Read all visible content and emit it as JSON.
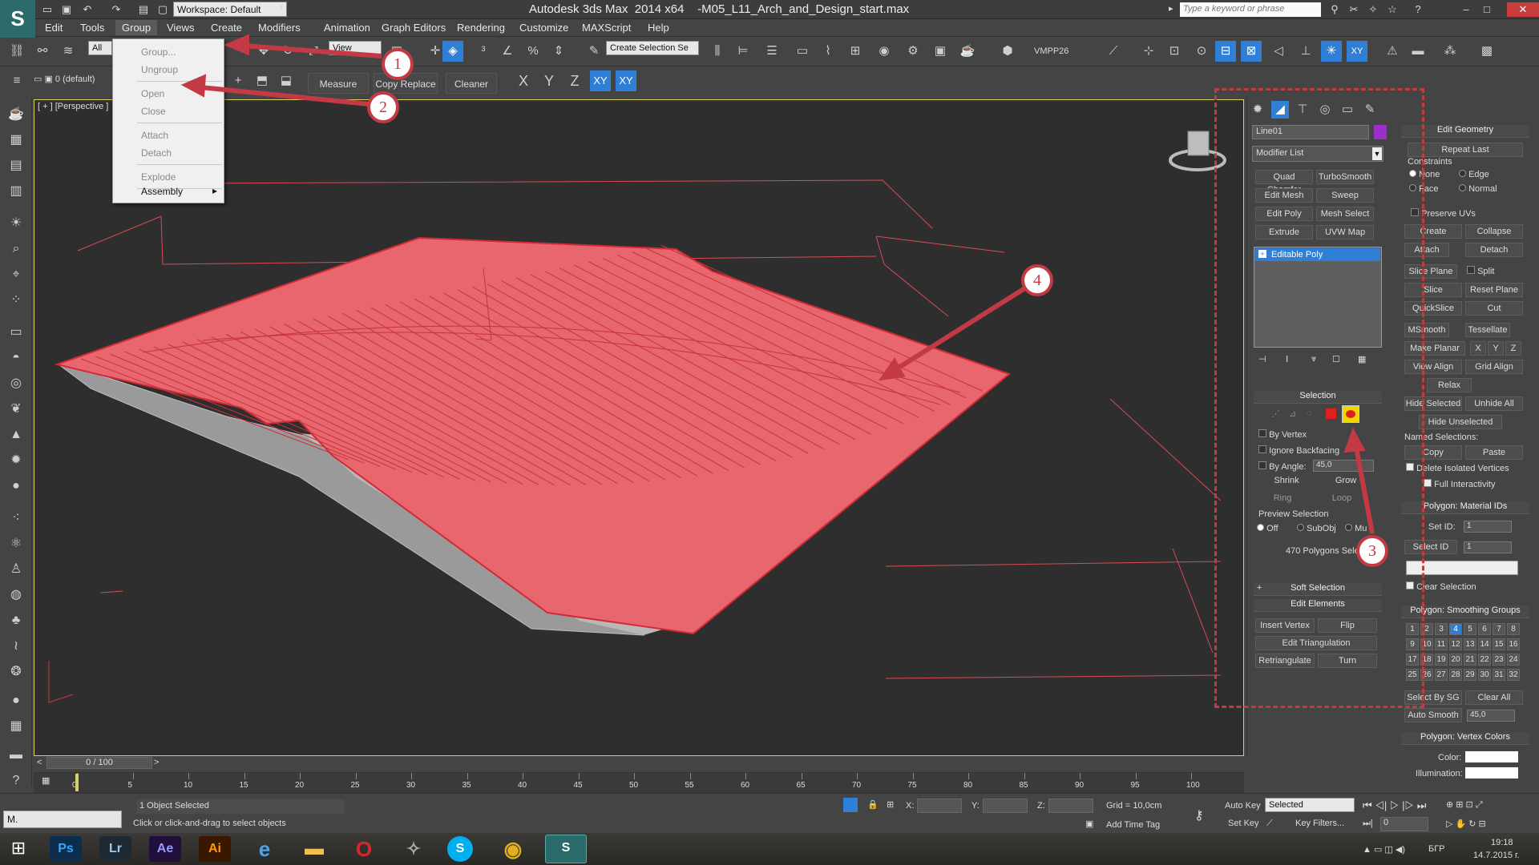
{
  "title": {
    "app": "Autodesk 3ds Max  2014 x64",
    "file": "-M05_L11_Arch_and_Design_start.max",
    "workspace": "Workspace: Default",
    "search_placeholder": "Type a keyword or phrase"
  },
  "menu": [
    "Edit",
    "Tools",
    "Group",
    "Views",
    "Create",
    "Modifiers",
    "Animation",
    "Graph Editors",
    "Rendering",
    "Customize",
    "MAXScript",
    "Help"
  ],
  "group_menu": {
    "items": [
      "Group...",
      "Ungroup",
      "Open",
      "Close",
      "Attach",
      "Detach",
      "Explode",
      "Assembly"
    ],
    "submenu_arrow": "▸"
  },
  "toolbar": {
    "filter": "All",
    "view_dropdown": "View",
    "create_selection": "Create Selection Se",
    "vmpp": "VMPP26",
    "layer": "0 (default)",
    "measure": "Measure",
    "copy_replace": "Copy Replace",
    "cleaner": "Cleaner",
    "axis_x": "X",
    "axis_y": "Y",
    "axis_z": "Z",
    "axis_xy": "XY",
    "axis_xy2": "XY"
  },
  "viewport": {
    "label": "[ + ] [Perspective ]"
  },
  "command_panel": {
    "object_name": "Line01",
    "modifier_list": "Modifier List",
    "modifier_buttons": [
      [
        "Quad Chamfer",
        "TurboSmooth"
      ],
      [
        "Edit Mesh",
        "Sweep"
      ],
      [
        "Edit Poly",
        "Mesh Select"
      ],
      [
        "Extrude",
        "UVW Map"
      ]
    ],
    "stack_item": "Editable Poly",
    "selection": {
      "title": "Selection",
      "by_vertex": "By Vertex",
      "ignore_backfacing": "Ignore Backfacing",
      "by_angle": "By Angle:",
      "angle_value": "45,0",
      "shrink": "Shrink",
      "grow": "Grow",
      "ring": "Ring",
      "loop": "Loop",
      "preview_selection": "Preview Selection",
      "off": "Off",
      "subobj": "SubObj",
      "multi": "Mu",
      "status": "470 Polygons Sele"
    },
    "soft_selection": "Soft Selection",
    "edit_elements": {
      "title": "Edit Elements",
      "insert_vertex": "Insert Vertex",
      "flip": "Flip",
      "edit_triangulation": "Edit Triangulation",
      "retriangulate": "Retriangulate",
      "turn": "Turn"
    }
  },
  "edit_geometry": {
    "title": "Edit Geometry",
    "repeat_last": "Repeat Last",
    "constraints": "Constraints",
    "none": "None",
    "edge": "Edge",
    "face": "Face",
    "normal": "Normal",
    "preserve_uvs": "Preserve UVs",
    "create": "Create",
    "collapse": "Collapse",
    "attach": "Attach",
    "detach": "Detach",
    "slice_plane": "Slice Plane",
    "split": "Split",
    "slice": "Slice",
    "reset_plane": "Reset Plane",
    "quickslice": "QuickSlice",
    "cut": "Cut",
    "msmooth": "MSmooth",
    "tessellate": "Tessellate",
    "make_planar": "Make Planar",
    "x": "X",
    "y": "Y",
    "z": "Z",
    "view_align": "View Align",
    "grid_align": "Grid Align",
    "relax": "Relax",
    "hide_selected": "Hide Selected",
    "unhide_all": "Unhide All",
    "hide_unselected": "Hide Unselected",
    "named_selections": "Named Selections:",
    "copy": "Copy",
    "paste": "Paste",
    "delete_isolated": "Delete Isolated Vertices",
    "full_interactivity": "Full Interactivity"
  },
  "material_ids": {
    "title": "Polygon: Material IDs",
    "set_id": "Set ID:",
    "set_id_value": "1",
    "select_id": "Select ID",
    "select_id_value": "1",
    "clear_selection": "Clear Selection"
  },
  "smoothing": {
    "title": "Polygon: Smoothing Groups",
    "groups": [
      "1",
      "2",
      "3",
      "4",
      "5",
      "6",
      "7",
      "8",
      "9",
      "10",
      "11",
      "12",
      "13",
      "14",
      "15",
      "16",
      "17",
      "18",
      "19",
      "20",
      "21",
      "22",
      "23",
      "24",
      "25",
      "26",
      "27",
      "28",
      "29",
      "30",
      "31",
      "32"
    ],
    "active": "4",
    "select_by_sg": "Select By SG",
    "clear_all": "Clear All",
    "auto_smooth": "Auto Smooth",
    "auto_smooth_value": "45,0"
  },
  "vertex_colors": {
    "title": "Polygon: Vertex Colors",
    "color": "Color:",
    "illumination": "Illumination:"
  },
  "timeline": {
    "frame": "0 / 100",
    "ticks": [
      "0",
      "5",
      "10",
      "15",
      "20",
      "25",
      "30",
      "35",
      "40",
      "45",
      "50",
      "55",
      "60",
      "65",
      "70",
      "75",
      "80",
      "85",
      "90",
      "95",
      "100"
    ]
  },
  "status": {
    "mini": "M.",
    "selected": "1 Object Selected",
    "hint": "Click or click-and-drag to select objects",
    "x": "X:",
    "y": "Y:",
    "z": "Z:",
    "grid": "Grid = 10,0cm",
    "add_time_tag": "Add Time Tag",
    "auto_key": "Auto Key",
    "set_key": "Set Key",
    "selected_dd": "Selected",
    "key_filters": "Key Filters...",
    "frame_value": "0"
  },
  "taskbar": {
    "apps": [
      "Ps",
      "Lr",
      "Ae",
      "Ai"
    ],
    "lang": "БГР",
    "time": "19:18",
    "date": "14.7.2015 г."
  },
  "callouts": [
    "1",
    "2",
    "3",
    "4"
  ],
  "colors": {
    "accent": "#c33a44",
    "mesh_fill": "#e8666d",
    "mesh_line": "#d42a35",
    "panel": "#444444"
  }
}
